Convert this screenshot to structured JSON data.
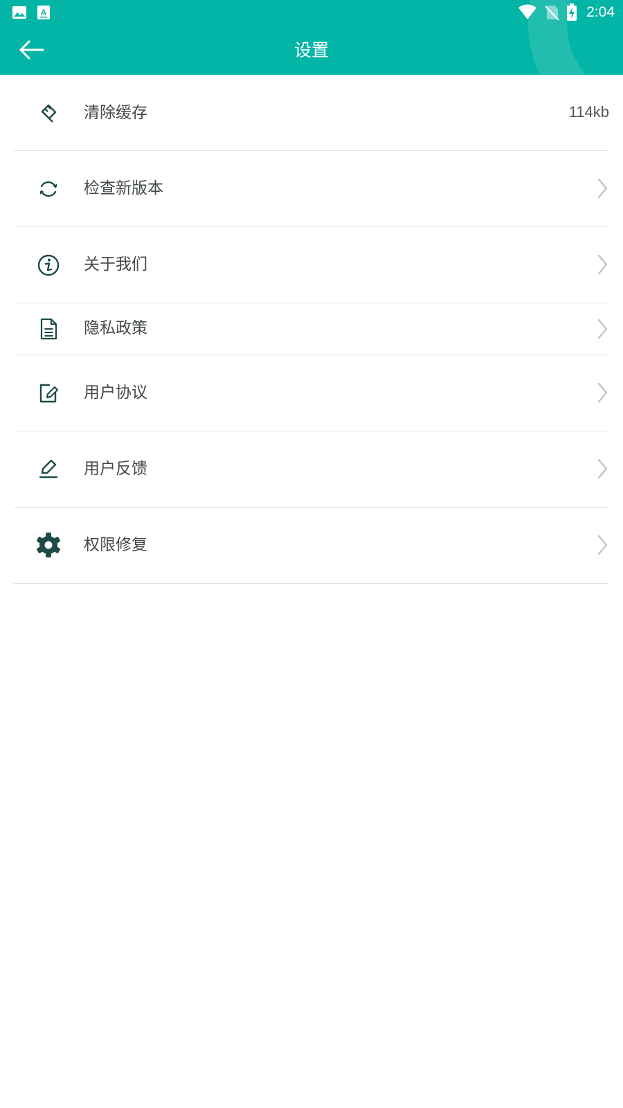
{
  "status_bar": {
    "time": "2:04",
    "left_icons": [
      "image-icon",
      "app-a-icon"
    ],
    "right_icons": [
      "wifi-icon",
      "no-sim-icon",
      "battery-charging-icon"
    ]
  },
  "header": {
    "title": "设置",
    "back_icon": "arrow-left-icon",
    "background_color": "#03B5A6"
  },
  "settings": {
    "items": [
      {
        "label": "清除缓存",
        "icon": "broom-icon",
        "value": "114kb"
      },
      {
        "label": "检查新版本",
        "icon": "refresh-icon"
      },
      {
        "label": "关于我们",
        "icon": "info-circle-icon"
      },
      {
        "label": "隐私政策",
        "icon": "document-icon"
      },
      {
        "label": "用户协议",
        "icon": "edit-document-icon"
      },
      {
        "label": "用户反馈",
        "icon": "pencil-icon"
      },
      {
        "label": "权限修复",
        "icon": "gear-icon"
      }
    ],
    "chevron_icon": "chevron-right-icon",
    "icon_color": "#1f4a4a"
  }
}
